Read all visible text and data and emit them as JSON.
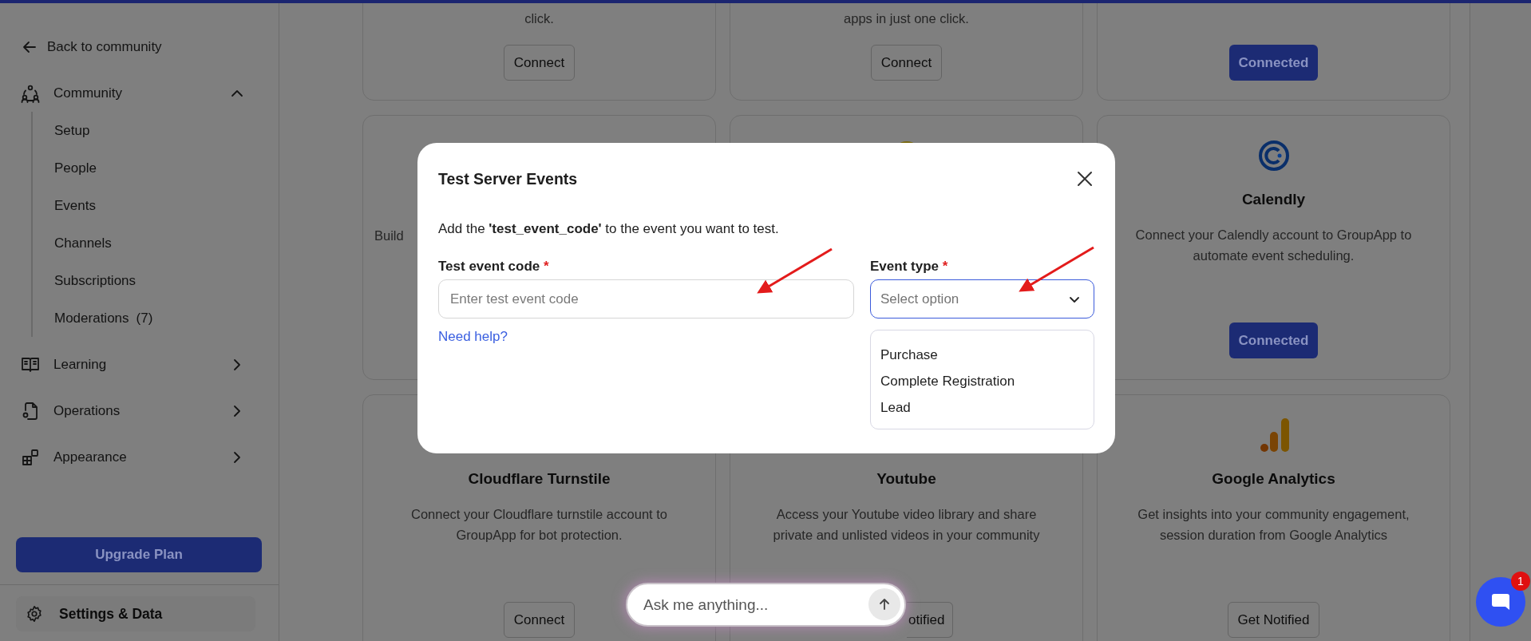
{
  "sidebar": {
    "back_link": "Back to community",
    "groups": [
      {
        "label": "Community",
        "expanded": true,
        "children": [
          {
            "label": "Setup"
          },
          {
            "label": "People"
          },
          {
            "label": "Events"
          },
          {
            "label": "Channels"
          },
          {
            "label": "Subscriptions"
          },
          {
            "label": "Moderations",
            "count": "(7)"
          }
        ]
      },
      {
        "label": "Learning",
        "expanded": false
      },
      {
        "label": "Operations",
        "expanded": false
      },
      {
        "label": "Appearance",
        "expanded": false
      }
    ],
    "upgrade_button": "Upgrade Plan",
    "settings": "Settings & Data"
  },
  "integrations": {
    "rows": [
      [
        {
          "description": "click.",
          "button": {
            "label": "Connect",
            "kind": "connect"
          }
        },
        {
          "description": "apps in just one click.",
          "button": {
            "label": "Connect",
            "kind": "connect"
          }
        },
        {
          "button": {
            "label": "Connected",
            "kind": "connected"
          }
        }
      ],
      [
        {
          "description": "Build",
          "covered": true
        },
        {},
        {
          "title": "Calendly",
          "description": "Connect your Calendly account to GroupApp to\nautomate event scheduling.",
          "button": {
            "label": "Connected",
            "kind": "connected"
          }
        }
      ],
      [
        {
          "title": "Cloudflare Turnstile",
          "description": "Connect your Cloudflare turnstile account to\nGroupApp for bot protection.",
          "button": {
            "label": "Connect",
            "kind": "connect"
          }
        },
        {
          "title": "Youtube",
          "description": "Access your Youtube video library and share\nprivate and unlisted videos in your community",
          "button": {
            "label": "otified",
            "kind": "connect",
            "cut_left": true
          }
        },
        {
          "title": "Google Analytics",
          "description": "Get insights into your community engagement,\nsession duration from Google Analytics",
          "button": {
            "label": "Get Notified",
            "kind": "connect"
          }
        }
      ]
    ]
  },
  "modal": {
    "title": "Test Server Events",
    "description": "Add the **'test_event_code'** to the event you want to test.",
    "fields": [
      {
        "kind": "text",
        "label": "Test event code",
        "required_mark": "*",
        "placeholder": "Enter test event code",
        "focused": false,
        "arrow": true,
        "help_link": "Need help?"
      },
      {
        "kind": "select",
        "label": "Event type",
        "required_mark": "*",
        "placeholder": "Select option",
        "focused": true,
        "arrow": true,
        "open": true,
        "options": [
          {
            "label": "Purchase",
            "selected": false
          },
          {
            "label": "Complete Registration",
            "selected": false
          },
          {
            "label": "Lead",
            "selected": false
          }
        ]
      }
    ]
  },
  "ask_box": {
    "placeholder": "Ask me anything..."
  },
  "chat_launcher": {
    "badge": "1"
  }
}
